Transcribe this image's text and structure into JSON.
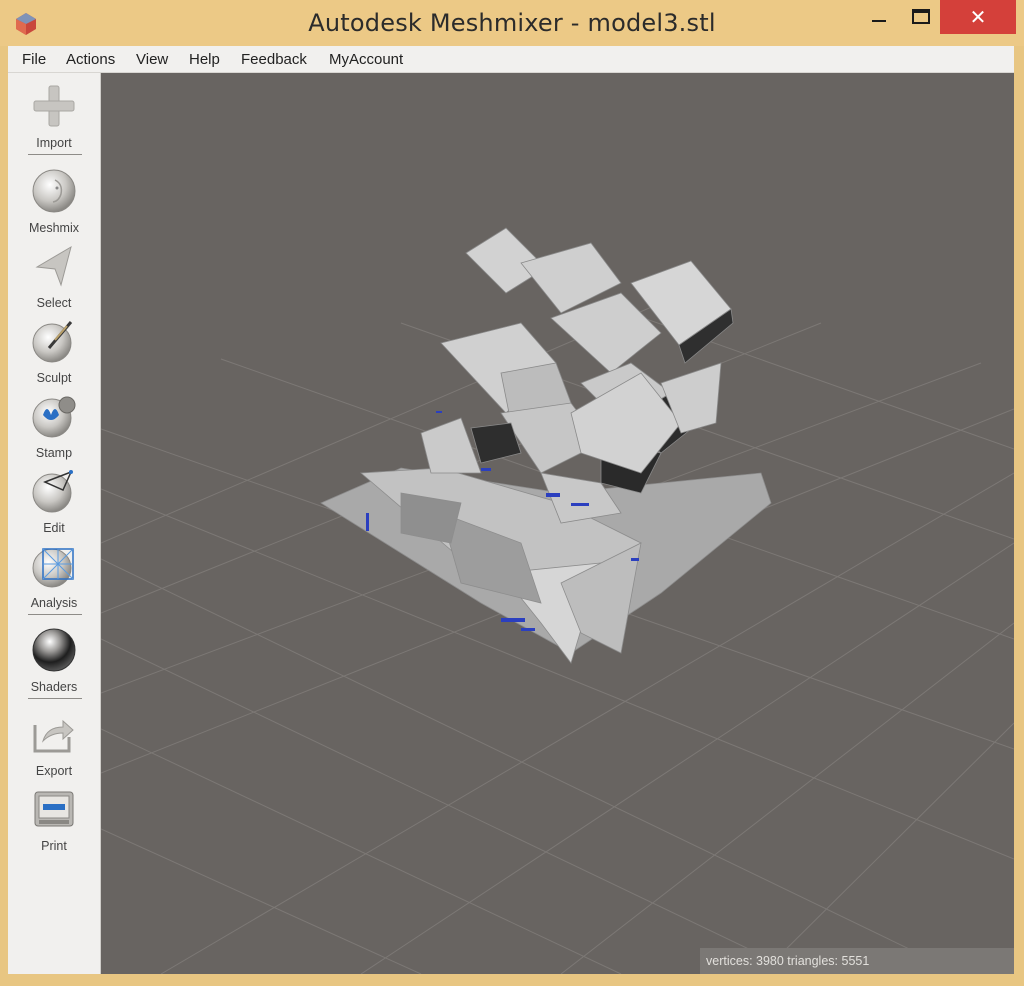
{
  "window": {
    "title": "Autodesk Meshmixer - model3.stl",
    "close_glyph": "✕"
  },
  "menu": {
    "items": [
      "File",
      "Actions",
      "View",
      "Help",
      "Feedback",
      "MyAccount"
    ]
  },
  "sidebar": {
    "tools": [
      {
        "label": "Import",
        "icon": "plus-icon"
      },
      {
        "label": "Meshmix",
        "icon": "face-sphere-icon"
      },
      {
        "label": "Select",
        "icon": "arrow-cursor-icon"
      },
      {
        "label": "Sculpt",
        "icon": "brush-sphere-icon"
      },
      {
        "label": "Stamp",
        "icon": "stamp-sphere-icon"
      },
      {
        "label": "Edit",
        "icon": "edit-sphere-icon"
      },
      {
        "label": "Analysis",
        "icon": "analysis-sphere-icon"
      },
      {
        "label": "Shaders",
        "icon": "shader-sphere-icon"
      },
      {
        "label": "Export",
        "icon": "export-icon"
      },
      {
        "label": "Print",
        "icon": "printer-icon"
      }
    ]
  },
  "status": {
    "text": "vertices: 3980 triangles: 5551"
  },
  "colors": {
    "titlebar": "#ecc986",
    "close": "#d4403a",
    "viewport": "#686461",
    "panel": "#f1f0ee"
  }
}
